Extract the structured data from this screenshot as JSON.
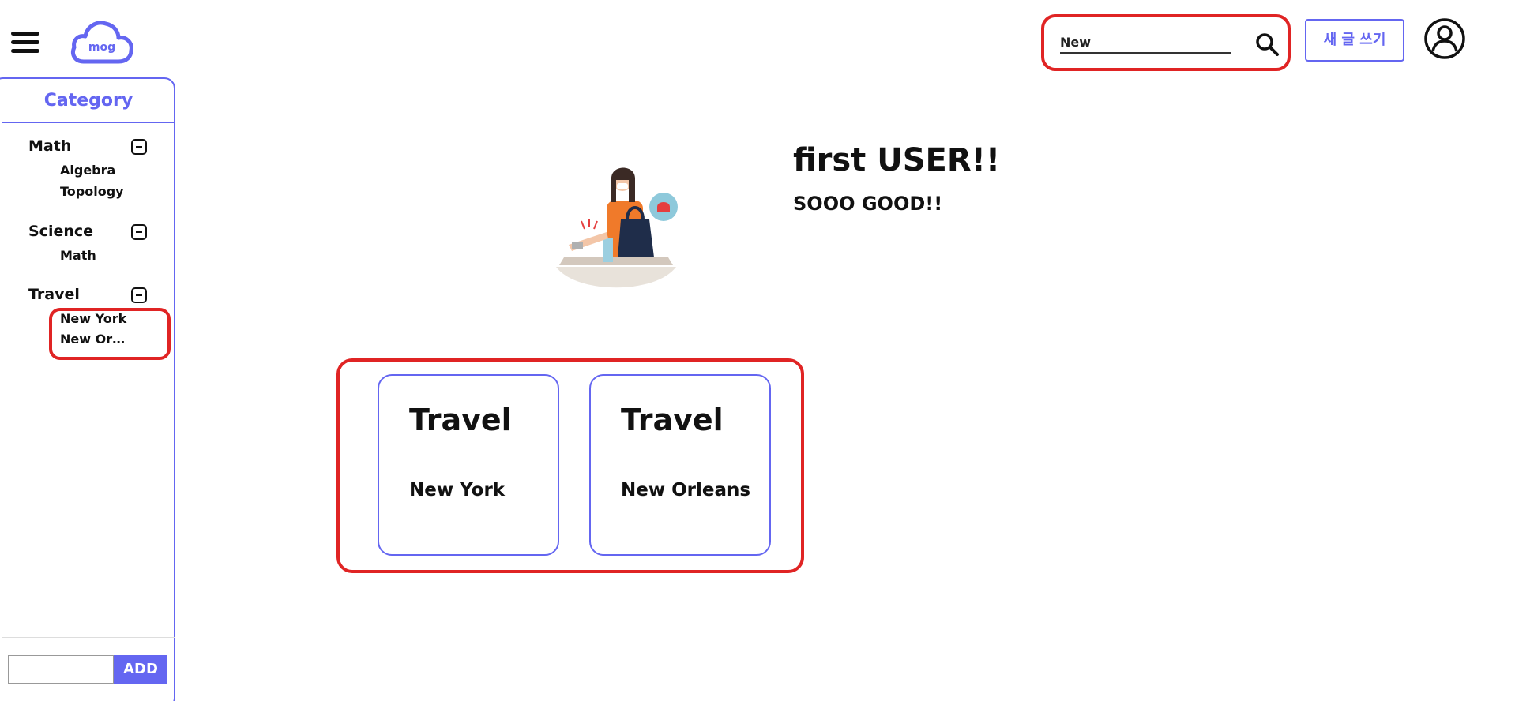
{
  "header": {
    "logo_text": "mog",
    "search": {
      "value": "New",
      "placeholder": ""
    },
    "write_label": "새 글 쓰기"
  },
  "sidebar": {
    "title": "Category",
    "groups": [
      {
        "name": "Math",
        "items": [
          "Algebra",
          "Topology"
        ]
      },
      {
        "name": "Science",
        "items": [
          "Math"
        ]
      },
      {
        "name": "Travel",
        "items": [
          "New York",
          "New Orleans"
        ]
      }
    ],
    "add_label": "ADD",
    "add_input_value": ""
  },
  "profile": {
    "username": "first USER!!",
    "bio": "SOOO GOOD!!"
  },
  "posts": [
    {
      "category": "Travel",
      "title": "New York"
    },
    {
      "category": "Travel",
      "title": "New Orleans"
    }
  ],
  "colors": {
    "accent": "#6466f1",
    "highlight": "#e02424"
  },
  "icons": [
    "hamburger-menu-icon",
    "cloud-logo-icon",
    "search-icon",
    "user-avatar-icon",
    "collapse-minus-icon"
  ]
}
